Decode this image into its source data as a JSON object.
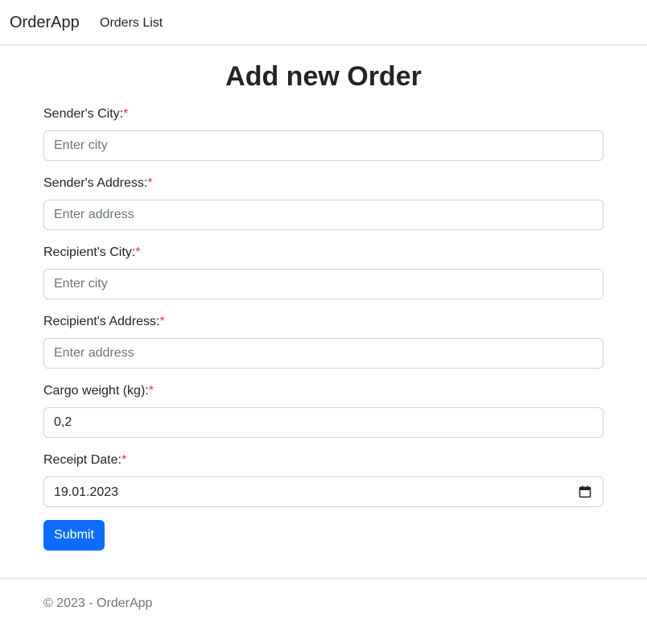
{
  "navbar": {
    "brand": "OrderApp",
    "links": [
      {
        "label": "Orders List"
      }
    ]
  },
  "page": {
    "title": "Add new Order"
  },
  "form": {
    "required_marker": "*",
    "fields": [
      {
        "label": "Sender's City:",
        "placeholder": "Enter city",
        "value": ""
      },
      {
        "label": "Sender's Address:",
        "placeholder": "Enter address",
        "value": ""
      },
      {
        "label": "Recipient's City:",
        "placeholder": "Enter city",
        "value": ""
      },
      {
        "label": "Recipient's Address:",
        "placeholder": "Enter address",
        "value": ""
      },
      {
        "label": "Cargo weight (kg):",
        "placeholder": "",
        "value": "0,2"
      },
      {
        "label": "Receipt Date:",
        "value": "19.01.2023",
        "icon": "calendar-icon"
      }
    ],
    "submit_label": "Submit"
  },
  "footer": {
    "prefix": "© 2023 - ",
    "link": "OrderApp"
  },
  "colors": {
    "primary": "#0d6efd",
    "required": "#dc3545",
    "muted": "#6c757d",
    "border": "#ced4da"
  }
}
